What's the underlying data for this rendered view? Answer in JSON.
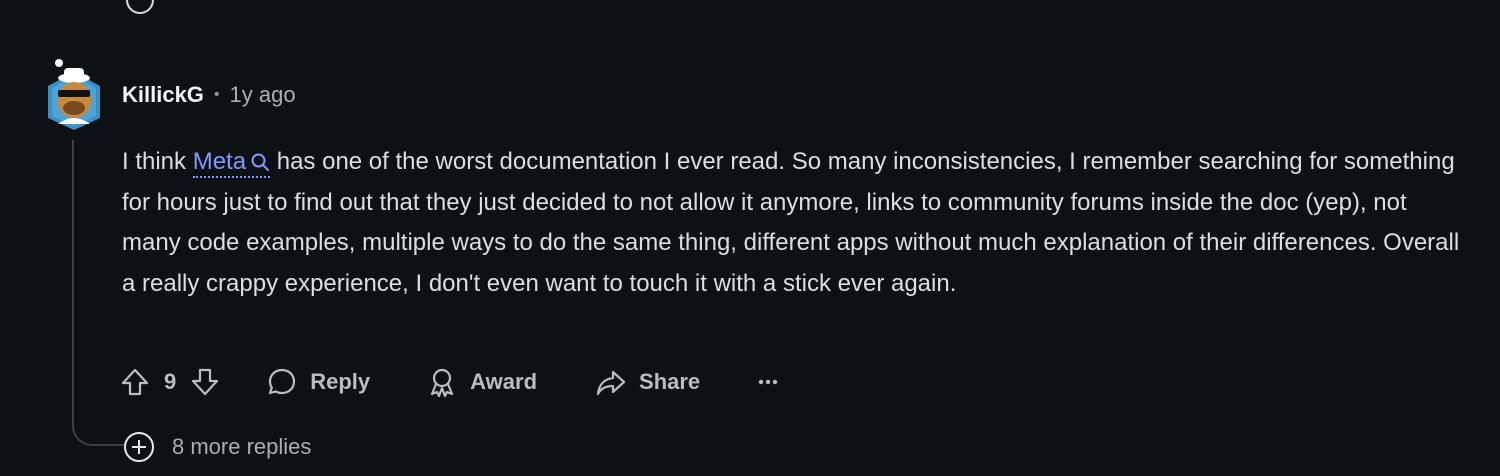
{
  "comment": {
    "username": "KillickG",
    "separator": "•",
    "time": "1y ago",
    "text_before_link": "I think ",
    "link_text": "Meta",
    "text_after_link": " has one of the worst documentation I ever read. So many inconsistencies, I remember searching for something for hours just to find out that they just decided to not allow it anymore, links to community forums inside the doc (yep), not many code examples, multiple ways to do the same thing, different apps without much explanation of their differences. Overall a really crappy experience, I don't even want to touch it with a stick ever again."
  },
  "actions": {
    "vote_count": "9",
    "reply_label": "Reply",
    "award_label": "Award",
    "share_label": "Share",
    "more_icon": "ellipsis-icon"
  },
  "replies": {
    "more_label": "8 more replies"
  },
  "colors": {
    "background": "#0e1113",
    "link": "#8098ff",
    "thread_line": "#3a3f43"
  }
}
